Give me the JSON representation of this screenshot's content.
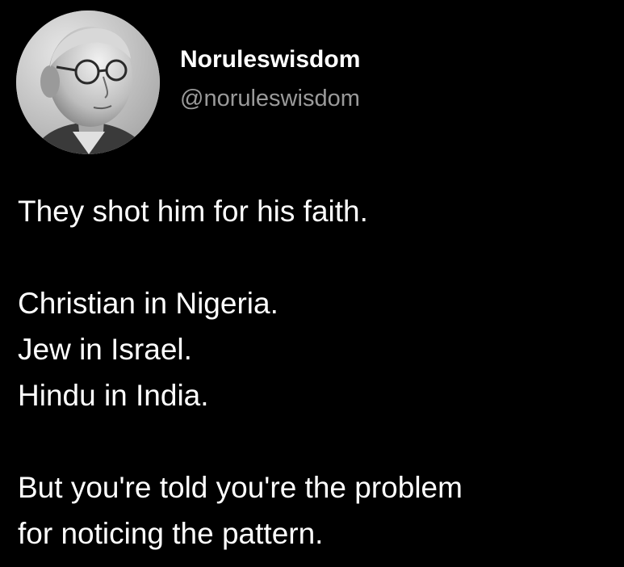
{
  "author": {
    "display_name": "Noruleswisdom",
    "handle": "@noruleswisdom",
    "avatar_icon": "profile-photo-icon"
  },
  "post": {
    "lines": [
      "They shot him for his faith.",
      "Christian in Nigeria.",
      "Jew in Israel.",
      "Hindu in India.",
      "But you're told you're the problem",
      "for noticing the pattern."
    ]
  },
  "colors": {
    "background": "#000000",
    "text": "#ffffff",
    "handle": "#9a9a9a"
  }
}
